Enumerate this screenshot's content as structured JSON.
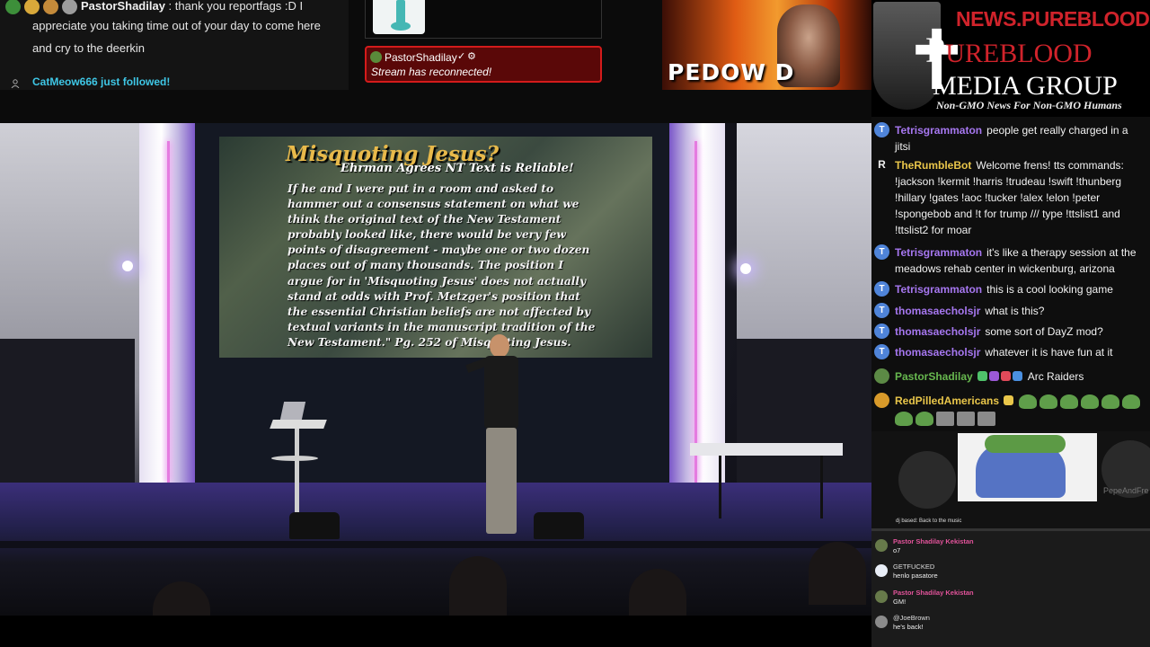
{
  "top_chat": {
    "username": "PastorShadilay",
    "message_start": "thank you reportfags :D I",
    "message_rest": "appreciate you taking time out of your day to come here and cry to the deerkin",
    "follow_notice": "CatMeow666 just followed!"
  },
  "alert": {
    "username": "PastorShadilay",
    "message": "Stream has reconnected!"
  },
  "promo": {
    "word": "PEDOW  D"
  },
  "logo": {
    "url": "NEWS.PUREBLOOD.MEDIA",
    "line1_a": "URE",
    "line1_b": "BLOOD",
    "line2": "MEDIA GROUP",
    "tagline": "Non-GMO News For Non-GMO Humans"
  },
  "slide": {
    "title": "Misquoting Jesus?",
    "subtitle": "Ehrman Agrees NT Text is Reliable!",
    "quote": "If he and I were put in a room and asked to hammer out a consensus statement on what we think the original text of the New Testament probably looked like, there would be very few points of disagreement - maybe one or two dozen places out of many thousands.  The position I argue for in 'Misquoting Jesus' does not actually stand at odds with Prof. Metzger's position that the essential Christian beliefs are not affected by textual variants in the manuscript tradition of the New Testament.\"  Pg. 252 of Misquoting Jesus."
  },
  "chat": {
    "messages": [
      {
        "user": "Tetrisgrammaton",
        "text": "people get really charged in a jitsi",
        "icon": "T"
      },
      {
        "user": "TheRumbleBot",
        "text": "Welcome frens! tts commands: !jackson !kermit !harris !trudeau !swift !thunberg !hillary !gates !aoc !tucker !alex !elon !peter !spongebob and !t for trump /// type !ttslist1 and !ttslist2 for moar",
        "icon": "R"
      },
      {
        "user": "Tetrisgrammaton",
        "text": "it's like a therapy session at the meadows rehab center in wickenburg, arizona",
        "icon": "T"
      },
      {
        "user": "Tetrisgrammaton",
        "text": "this is a cool looking game",
        "icon": "T"
      },
      {
        "user": "thomasaecholsjr",
        "text": "what is this?",
        "icon": "T"
      },
      {
        "user": "thomasaecholsjr",
        "text": "some sort of DayZ mod?",
        "icon": "T"
      },
      {
        "user": "thomasaecholsjr",
        "text": "whatever it is have fun at it",
        "icon": "T"
      },
      {
        "user": "PastorShadilay",
        "text": "Arc Raiders",
        "icon": ""
      },
      {
        "user": "RedPilledAmericans",
        "text": "",
        "icon": ""
      }
    ]
  },
  "embed": {
    "watermark": "PepeAndFre",
    "caption": "dj based: Back to the music",
    "messages": [
      {
        "user": "Pastor Shadilay Kekistan",
        "text": "o7"
      },
      {
        "user": "GETFUCKED",
        "text": "henlo pasatore"
      },
      {
        "user": "Pastor Shadilay Kekistan",
        "text": "GM!"
      },
      {
        "user": "@JoeBrown",
        "text": "he's back!"
      }
    ]
  },
  "colors": {
    "alert_bg": "#5a0808",
    "alert_border": "#d41b1b",
    "follow_text": "#3fc7e6",
    "logo_red": "#d0232b",
    "chat_username_purple": "#a677f0",
    "chat_username_yellow": "#e9c64a",
    "chat_username_green": "#67b84f"
  }
}
